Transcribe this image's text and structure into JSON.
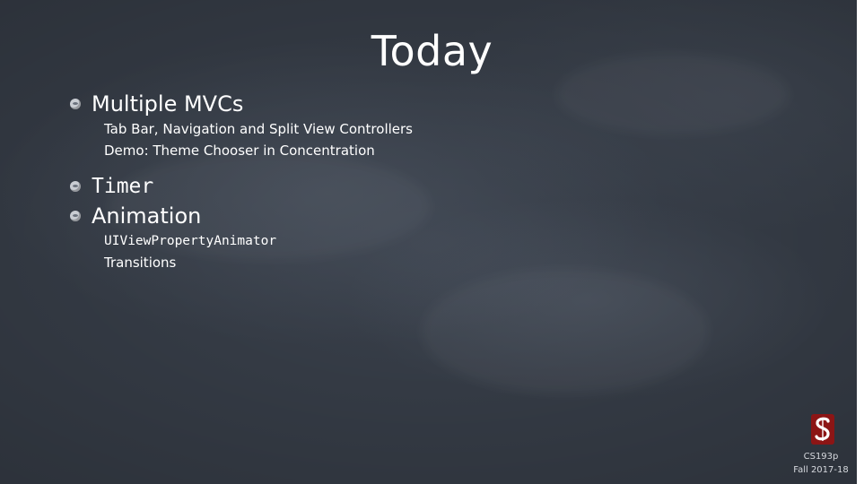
{
  "slide": {
    "title": "Today",
    "bullets": [
      {
        "label": "Multiple MVCs",
        "subitems": [
          "Tab Bar, Navigation and Split View Controllers",
          "Demo: Theme Chooser in Concentration"
        ]
      },
      {
        "label": "Timer",
        "subitems": []
      },
      {
        "label": "Animation",
        "subitems": [
          "UIViewPropertyAnimator",
          "Transitions"
        ]
      }
    ]
  },
  "footer": {
    "course": "CS193p",
    "term": "Fall 2017-18",
    "logo_color": "#8c1515"
  }
}
